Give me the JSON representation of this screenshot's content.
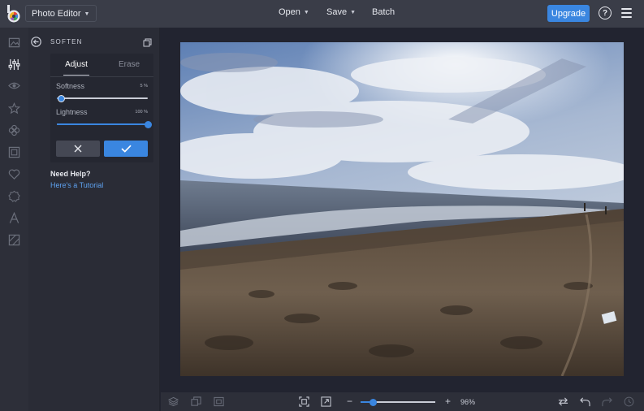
{
  "topbar": {
    "app_name": "Photo Editor",
    "menu": [
      {
        "label": "Open",
        "has_dropdown": true
      },
      {
        "label": "Save",
        "has_dropdown": true
      },
      {
        "label": "Batch",
        "has_dropdown": false
      }
    ],
    "upgrade_label": "Upgrade",
    "help_label": "?",
    "brand_color": "#3a86e0"
  },
  "rail": {
    "items": [
      "image-icon",
      "sliders-icon",
      "eye-icon",
      "star-icon",
      "clover-icon",
      "frame-icon",
      "heart-icon",
      "badge-icon",
      "text-icon",
      "texture-icon"
    ],
    "active": "sliders-icon"
  },
  "panel": {
    "title": "SOFTEN",
    "tabs": {
      "active": "Adjust",
      "inactive": "Erase"
    },
    "sliders": [
      {
        "label": "Softness",
        "value_text": "5 %",
        "value": 0.05
      },
      {
        "label": "Lightness",
        "value_text": "100 %",
        "value": 1.0
      }
    ],
    "cancel_icon": "close-icon",
    "apply_icon": "checkmark-icon",
    "help_heading": "Need Help?",
    "help_link": "Here's a Tutorial"
  },
  "canvas": {
    "image_description_icon": "photo"
  },
  "bottombar": {
    "left_icons": [
      "layers-icon",
      "duplicate-icon",
      "film-icon"
    ],
    "fit_icons": [
      "fit-screen-icon",
      "expand-icon"
    ],
    "zoom_out": "−",
    "zoom_in": "+",
    "zoom_text": "96%",
    "zoom_value": 0.17,
    "right_icons": [
      "compare-icon",
      "undo-icon",
      "redo-icon",
      "history-icon"
    ]
  }
}
